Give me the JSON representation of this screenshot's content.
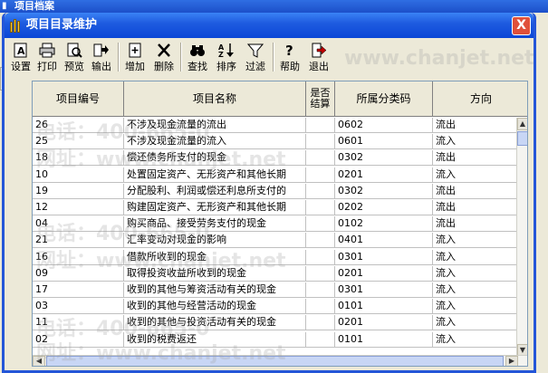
{
  "background_window": {
    "title": "项目档案"
  },
  "dialog": {
    "title": "项目目录维护",
    "close_label": "X"
  },
  "toolbar": {
    "buttons": [
      {
        "label": "设置",
        "icon": "settings-icon"
      },
      {
        "label": "打印",
        "icon": "printer-icon"
      },
      {
        "label": "预览",
        "icon": "preview-icon"
      },
      {
        "label": "输出",
        "icon": "export-icon"
      },
      {
        "label": "增加",
        "icon": "add-icon"
      },
      {
        "label": "删除",
        "icon": "delete-icon"
      },
      {
        "label": "查找",
        "icon": "binoculars-icon"
      },
      {
        "label": "排序",
        "icon": "sort-icon"
      },
      {
        "label": "过滤",
        "icon": "filter-icon"
      },
      {
        "label": "帮助",
        "icon": "help-icon"
      },
      {
        "label": "退出",
        "icon": "exit-icon"
      }
    ]
  },
  "grid": {
    "columns": [
      "项目编号",
      "项目名称",
      "是否结算",
      "所属分类码",
      "方向"
    ],
    "rows": [
      [
        "26",
        "不涉及现金流量的流出",
        "",
        "0602",
        "流出"
      ],
      [
        "25",
        "不涉及现金流量的流入",
        "",
        "0601",
        "流入"
      ],
      [
        "18",
        "偿还债务所支付的现金",
        "",
        "0302",
        "流出"
      ],
      [
        "10",
        "处置固定资产、无形资产和其他长期",
        "",
        "0201",
        "流入"
      ],
      [
        "19",
        "分配股利、利润或偿还利息所支付的",
        "",
        "0302",
        "流出"
      ],
      [
        "12",
        "购建固定资产、无形资产和其他长期",
        "",
        "0202",
        "流出"
      ],
      [
        "04",
        "购买商品、接受劳务支付的现金",
        "",
        "0102",
        "流出"
      ],
      [
        "21",
        "汇率变动对现金的影响",
        "",
        "0401",
        "流入"
      ],
      [
        "16",
        "借款所收到的现金",
        "",
        "0301",
        "流入"
      ],
      [
        "09",
        "取得投资收益所收到的现金",
        "",
        "0201",
        "流入"
      ],
      [
        "17",
        "收到的其他与筹资活动有关的现金",
        "",
        "0301",
        "流入"
      ],
      [
        "03",
        "收到的其他与经营活动的现金",
        "",
        "0101",
        "流入"
      ],
      [
        "11",
        "收到的其他与投资活动有关的现金",
        "",
        "0201",
        "流入"
      ],
      [
        "02",
        "收到的税费返还",
        "",
        "0101",
        "流入"
      ]
    ]
  },
  "watermarks": [
    "www.chanjet.net",
    "电话：400-665-0",
    "网址：www.chanjet.net",
    "电话：400-665-0",
    "网址：www.chanjet.net",
    "电话：400-665-0",
    "网址：www.chanjet.net"
  ],
  "colors": {
    "titlebar": "#0a46d6",
    "close": "#e0503a",
    "chrome": "#ece9d8"
  }
}
